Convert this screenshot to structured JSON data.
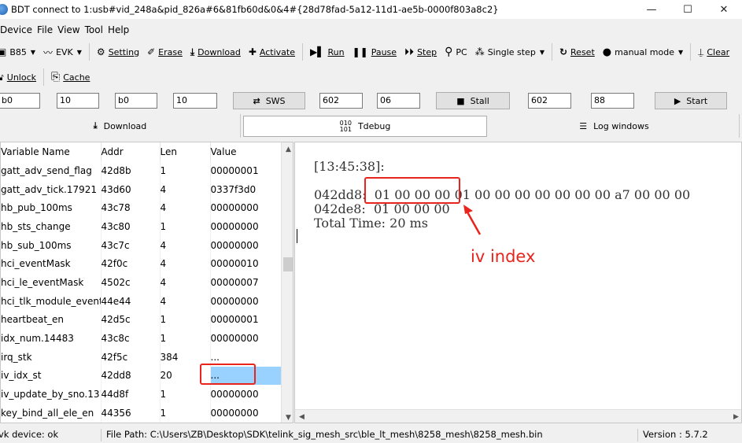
{
  "window": {
    "title": "BDT connect to 1:usb#vid_248a&pid_826a#6&81fb60d&0&4#{28d78fad-5a12-11d1-ae5b-0000f803a8c2}",
    "minimize": "—",
    "maximize": "☐",
    "close": "✕"
  },
  "menu": [
    "Device",
    "File",
    "View",
    "Tool",
    "Help"
  ],
  "toolbar1": {
    "chip": "B85",
    "board": "EVK",
    "setting": "Setting",
    "erase": "Erase",
    "download": "Download",
    "activate": "Activate",
    "run": "Run",
    "pause": "Pause",
    "step": "Step",
    "pc": "PC",
    "single_step": "Single step",
    "reset": "Reset",
    "manual_mode": "manual mode",
    "clear": "Clear"
  },
  "toolbar2": {
    "unlock": "Unlock",
    "cache": "Cache"
  },
  "params": {
    "f1": "b0",
    "f2": "10",
    "f3": "b0",
    "f4": "10",
    "sws": "SWS",
    "f5": "602",
    "f6": "06",
    "stall": "Stall",
    "f7": "602",
    "f8": "88",
    "start": "Start"
  },
  "tabs": {
    "download": "Download",
    "tdebug": "Tdebug",
    "log": "Log windows"
  },
  "variables": {
    "headers": [
      "Variable Name",
      "Addr",
      "Len",
      "Value"
    ],
    "rows": [
      [
        "gatt_adv_send_flag",
        "42d8b",
        "1",
        "00000001"
      ],
      [
        "gatt_adv_tick.17921",
        "43d60",
        "4",
        "0337f3d0"
      ],
      [
        "hb_pub_100ms",
        "43c78",
        "4",
        "00000000"
      ],
      [
        "hb_sts_change",
        "43c80",
        "1",
        "00000000"
      ],
      [
        "hb_sub_100ms",
        "43c7c",
        "4",
        "00000000"
      ],
      [
        "hci_eventMask",
        "42f0c",
        "4",
        "00000010"
      ],
      [
        "hci_le_eventMask",
        "4502c",
        "4",
        "00000007"
      ],
      [
        "hci_tlk_module_event",
        "44e44",
        "4",
        "00000000"
      ],
      [
        "heartbeat_en",
        "42d5c",
        "1",
        "00000001"
      ],
      [
        "idx_num.14483",
        "43c8c",
        "1",
        "00000000"
      ],
      [
        "irq_stk",
        "42f5c",
        "384",
        "..."
      ],
      [
        "iv_idx_st",
        "42dd8",
        "20",
        "..."
      ],
      [
        "iv_update_by_sno.131",
        "44d8f",
        "1",
        "00000000"
      ],
      [
        "key_bind_all_ele_en",
        "44356",
        "1",
        "00000000"
      ]
    ]
  },
  "log": {
    "time": "[13:45:38]:",
    "line1_addr": "042dd8:",
    "line1_iv": "01 00 00 00",
    "line1_rest": "01 00 00 00 00 00 00 00 a7 00 00 00",
    "line2_addr": "042de8:",
    "line2_data": "01 00 00 00",
    "total": "Total Time: 20 ms"
  },
  "annotation": {
    "label": "iv index",
    "color": "#e8241c"
  },
  "status": {
    "device": "vk device: ok",
    "path": "File Path:  C:\\Users\\ZB\\Desktop\\SDK\\telink_sig_mesh_src\\ble_lt_mesh\\8258_mesh\\8258_mesh.bin",
    "version": "Version : 5.7.2"
  }
}
